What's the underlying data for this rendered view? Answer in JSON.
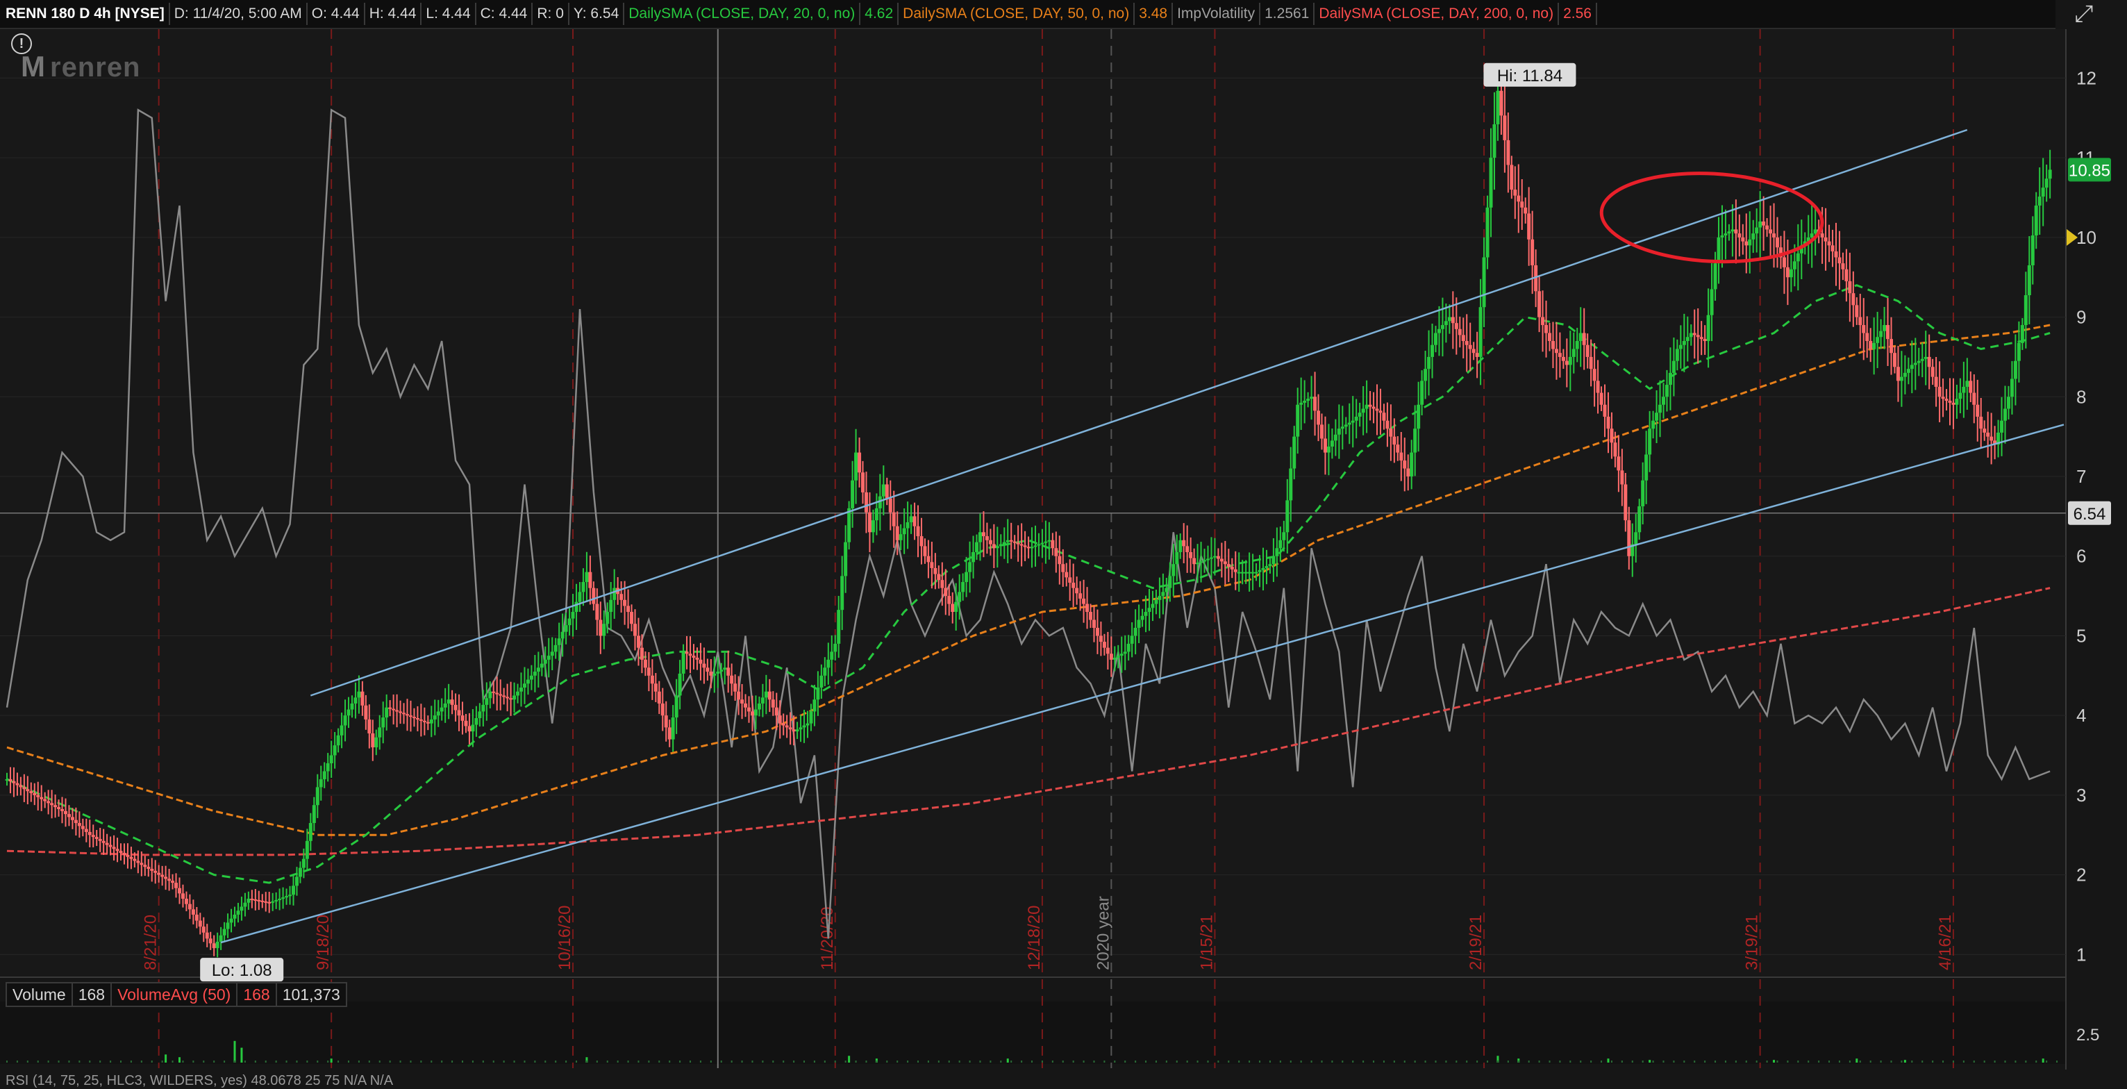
{
  "header": {
    "symbol": "RENN 180 D 4h [NYSE]",
    "date": "D: 11/4/20, 5:00 AM",
    "open": "O: 4.44",
    "high": "H: 4.44",
    "low": "L: 4.44",
    "close": "C: 4.44",
    "range": "R: 0",
    "y": "Y: 6.54",
    "sma20_label": "DailySMA (CLOSE, DAY, 20, 0, no)",
    "sma20_value": "4.62",
    "sma50_label": "DailySMA (CLOSE, DAY, 50, 0, no)",
    "sma50_value": "3.48",
    "iv_label": "ImpVolatility",
    "iv_value": "1.2561",
    "sma200_label": "DailySMA (CLOSE, DAY, 200, 0, no)",
    "sma200_value": "2.56"
  },
  "logo": {
    "text": "renren",
    "mark": "M"
  },
  "info_icon": "!",
  "close_icon": "⤢",
  "volume_header": {
    "label": "Volume",
    "value": "168",
    "avg_label": "VolumeAvg (50)",
    "avg_value": "168",
    "total": "101,373"
  },
  "volume_scale": "2.5",
  "rsi_header": "RSI (14, 75, 25, HLC3, WILDERS, yes)  48.0678  25  75  N/A  N/A",
  "colors": {
    "up": "#27c93f",
    "down": "#ff6b6b",
    "sma20": "#27c93f",
    "sma50": "#e8801a",
    "sma200": "#e04848",
    "iv": "#8a8a8a",
    "channel": "#7fb2d9",
    "annotation": "#e8202a",
    "price_badge": "#1aa33a",
    "marker": "#e0c020"
  },
  "chart_data": {
    "type": "candlestick",
    "title": "RENN 180 D 4h [NYSE]",
    "price_axis": {
      "ticks": [
        1,
        2,
        3,
        4,
        5,
        6,
        7,
        8,
        9,
        10,
        11,
        12
      ],
      "range": [
        0.75,
        12.3
      ]
    },
    "date_labels": [
      "8/21/20",
      "9/18/20",
      "10/16/20",
      "11/20/20",
      "12/18/20",
      "2020 year",
      "1/15/21",
      "2/19/21",
      "3/19/21",
      "4/16/21"
    ],
    "price_badges": {
      "last": "10.85",
      "crosshair": "6.54"
    },
    "high_label": "Hi: 11.84",
    "low_label": "Lo: 1.08",
    "hi": 11.84,
    "lo": 1.08,
    "last": 10.85,
    "crosshair": 6.54,
    "price_path": [
      [
        0,
        3.2
      ],
      [
        4,
        3.0
      ],
      [
        8,
        2.8
      ],
      [
        12,
        2.5
      ],
      [
        16,
        2.3
      ],
      [
        20,
        2.1
      ],
      [
        24,
        1.9
      ],
      [
        27,
        1.5
      ],
      [
        29,
        1.2
      ],
      [
        30,
        1.08
      ],
      [
        32,
        1.4
      ],
      [
        35,
        1.7
      ],
      [
        38,
        1.65
      ],
      [
        41,
        1.75
      ],
      [
        43,
        2.2
      ],
      [
        45,
        3.1
      ],
      [
        47,
        3.5
      ],
      [
        49,
        4.0
      ],
      [
        51,
        4.3
      ],
      [
        53,
        3.6
      ],
      [
        55,
        4.1
      ],
      [
        58,
        4.0
      ],
      [
        61,
        3.9
      ],
      [
        64,
        4.2
      ],
      [
        67,
        3.8
      ],
      [
        70,
        4.3
      ],
      [
        73,
        4.2
      ],
      [
        76,
        4.5
      ],
      [
        79,
        4.8
      ],
      [
        82,
        5.3
      ],
      [
        84,
        5.8
      ],
      [
        86,
        5.0
      ],
      [
        88,
        5.6
      ],
      [
        90,
        5.3
      ],
      [
        92,
        4.7
      ],
      [
        94,
        4.3
      ],
      [
        96,
        3.7
      ],
      [
        98,
        4.8
      ],
      [
        100,
        4.7
      ],
      [
        102,
        4.5
      ],
      [
        104,
        4.6
      ],
      [
        106,
        4.2
      ],
      [
        108,
        4.0
      ],
      [
        110,
        4.3
      ],
      [
        112,
        3.9
      ],
      [
        114,
        3.8
      ],
      [
        116,
        3.9
      ],
      [
        118,
        4.5
      ],
      [
        120,
        4.9
      ],
      [
        122,
        6.6
      ],
      [
        123,
        7.3
      ],
      [
        125,
        6.3
      ],
      [
        127,
        6.9
      ],
      [
        129,
        6.2
      ],
      [
        131,
        6.5
      ],
      [
        133,
        6.0
      ],
      [
        135,
        5.7
      ],
      [
        137,
        5.3
      ],
      [
        139,
        5.8
      ],
      [
        141,
        6.3
      ],
      [
        143,
        6.1
      ],
      [
        145,
        6.2
      ],
      [
        148,
        6.1
      ],
      [
        151,
        6.2
      ],
      [
        153,
        5.8
      ],
      [
        156,
        5.4
      ],
      [
        158,
        5.0
      ],
      [
        160,
        4.7
      ],
      [
        162,
        4.8
      ],
      [
        164,
        5.2
      ],
      [
        166,
        5.4
      ],
      [
        168,
        5.6
      ],
      [
        170,
        6.2
      ],
      [
        172,
        5.9
      ],
      [
        175,
        6.0
      ],
      [
        178,
        5.8
      ],
      [
        181,
        5.8
      ],
      [
        183,
        5.9
      ],
      [
        185,
        6.3
      ],
      [
        187,
        7.9
      ],
      [
        189,
        8.0
      ],
      [
        191,
        7.3
      ],
      [
        193,
        7.6
      ],
      [
        195,
        7.7
      ],
      [
        197,
        7.9
      ],
      [
        199,
        7.8
      ],
      [
        201,
        7.4
      ],
      [
        203,
        7.0
      ],
      [
        205,
        8.2
      ],
      [
        207,
        8.8
      ],
      [
        209,
        9.0
      ],
      [
        211,
        8.7
      ],
      [
        213,
        8.5
      ],
      [
        215,
        11.0
      ],
      [
        216,
        11.84
      ],
      [
        218,
        10.6
      ],
      [
        220,
        10.3
      ],
      [
        222,
        9.0
      ],
      [
        224,
        8.6
      ],
      [
        226,
        8.4
      ],
      [
        228,
        8.8
      ],
      [
        230,
        8.2
      ],
      [
        232,
        7.6
      ],
      [
        234,
        6.9
      ],
      [
        235,
        6.0
      ],
      [
        236,
        6.3
      ],
      [
        238,
        7.6
      ],
      [
        240,
        8.0
      ],
      [
        242,
        8.6
      ],
      [
        244,
        8.8
      ],
      [
        246,
        8.7
      ],
      [
        248,
        10.0
      ],
      [
        250,
        10.1
      ],
      [
        252,
        9.9
      ],
      [
        254,
        10.2
      ],
      [
        256,
        10.0
      ],
      [
        258,
        9.5
      ],
      [
        260,
        9.9
      ],
      [
        262,
        10.1
      ],
      [
        264,
        9.9
      ],
      [
        266,
        9.6
      ],
      [
        268,
        9.0
      ],
      [
        270,
        8.6
      ],
      [
        272,
        8.9
      ],
      [
        274,
        8.2
      ],
      [
        276,
        8.4
      ],
      [
        278,
        8.5
      ],
      [
        280,
        8.0
      ],
      [
        282,
        7.9
      ],
      [
        284,
        8.2
      ],
      [
        286,
        7.6
      ],
      [
        288,
        7.4
      ],
      [
        290,
        8.0
      ],
      [
        292,
        8.9
      ],
      [
        294,
        10.4
      ],
      [
        296,
        10.85
      ]
    ],
    "iv_path": [
      [
        0,
        4.1
      ],
      [
        3,
        5.7
      ],
      [
        5,
        6.2
      ],
      [
        8,
        7.3
      ],
      [
        11,
        7.0
      ],
      [
        13,
        6.3
      ],
      [
        15,
        6.2
      ],
      [
        17,
        6.3
      ],
      [
        19,
        11.6
      ],
      [
        21,
        11.5
      ],
      [
        23,
        9.2
      ],
      [
        25,
        10.4
      ],
      [
        27,
        7.3
      ],
      [
        29,
        6.2
      ],
      [
        31,
        6.5
      ],
      [
        33,
        6.0
      ],
      [
        35,
        6.3
      ],
      [
        37,
        6.6
      ],
      [
        39,
        6.0
      ],
      [
        41,
        6.4
      ],
      [
        43,
        8.4
      ],
      [
        45,
        8.6
      ],
      [
        47,
        11.6
      ],
      [
        49,
        11.5
      ],
      [
        51,
        8.9
      ],
      [
        53,
        8.3
      ],
      [
        55,
        8.6
      ],
      [
        57,
        8.0
      ],
      [
        59,
        8.4
      ],
      [
        61,
        8.1
      ],
      [
        63,
        8.7
      ],
      [
        65,
        7.2
      ],
      [
        67,
        6.9
      ],
      [
        69,
        4.2
      ],
      [
        71,
        4.5
      ],
      [
        73,
        5.1
      ],
      [
        75,
        6.9
      ],
      [
        77,
        5.3
      ],
      [
        79,
        3.9
      ],
      [
        81,
        5.3
      ],
      [
        83,
        9.1
      ],
      [
        85,
        6.8
      ],
      [
        87,
        5.1
      ],
      [
        89,
        5.0
      ],
      [
        91,
        4.7
      ],
      [
        93,
        5.2
      ],
      [
        95,
        4.6
      ],
      [
        97,
        4.2
      ],
      [
        99,
        4.5
      ],
      [
        101,
        4.0
      ],
      [
        103,
        4.8
      ],
      [
        105,
        3.6
      ],
      [
        107,
        5.0
      ],
      [
        109,
        3.3
      ],
      [
        111,
        3.6
      ],
      [
        113,
        4.6
      ],
      [
        115,
        2.9
      ],
      [
        117,
        3.5
      ],
      [
        119,
        1.2
      ],
      [
        121,
        4.2
      ],
      [
        123,
        5.2
      ],
      [
        125,
        6.0
      ],
      [
        127,
        5.5
      ],
      [
        129,
        6.2
      ],
      [
        131,
        5.4
      ],
      [
        133,
        5.0
      ],
      [
        135,
        5.4
      ],
      [
        137,
        5.7
      ],
      [
        139,
        5.0
      ],
      [
        141,
        5.2
      ],
      [
        143,
        5.8
      ],
      [
        145,
        5.4
      ],
      [
        147,
        4.9
      ],
      [
        149,
        5.2
      ],
      [
        151,
        5.0
      ],
      [
        153,
        5.1
      ],
      [
        155,
        4.6
      ],
      [
        157,
        4.4
      ],
      [
        159,
        4.0
      ],
      [
        161,
        4.8
      ],
      [
        163,
        3.3
      ],
      [
        165,
        4.9
      ],
      [
        167,
        4.4
      ],
      [
        169,
        6.3
      ],
      [
        171,
        5.1
      ],
      [
        173,
        6.0
      ],
      [
        175,
        5.6
      ],
      [
        177,
        4.1
      ],
      [
        179,
        5.3
      ],
      [
        181,
        4.8
      ],
      [
        183,
        4.2
      ],
      [
        185,
        5.6
      ],
      [
        187,
        3.3
      ],
      [
        189,
        6.1
      ],
      [
        191,
        5.4
      ],
      [
        193,
        4.8
      ],
      [
        195,
        3.1
      ],
      [
        197,
        5.2
      ],
      [
        199,
        4.3
      ],
      [
        201,
        4.9
      ],
      [
        203,
        5.5
      ],
      [
        205,
        6.0
      ],
      [
        207,
        4.6
      ],
      [
        209,
        3.8
      ],
      [
        211,
        4.9
      ],
      [
        213,
        4.3
      ],
      [
        215,
        5.2
      ],
      [
        217,
        4.5
      ],
      [
        219,
        4.8
      ],
      [
        221,
        5.0
      ],
      [
        223,
        5.9
      ],
      [
        225,
        4.4
      ],
      [
        227,
        5.2
      ],
      [
        229,
        4.9
      ],
      [
        231,
        5.3
      ],
      [
        233,
        5.1
      ],
      [
        235,
        5.0
      ],
      [
        237,
        5.4
      ],
      [
        239,
        5.0
      ],
      [
        241,
        5.2
      ],
      [
        243,
        4.7
      ],
      [
        245,
        4.8
      ],
      [
        247,
        4.3
      ],
      [
        249,
        4.5
      ],
      [
        251,
        4.1
      ],
      [
        253,
        4.3
      ],
      [
        255,
        4.0
      ],
      [
        257,
        4.9
      ],
      [
        259,
        3.9
      ],
      [
        261,
        4.0
      ],
      [
        263,
        3.9
      ],
      [
        265,
        4.1
      ],
      [
        267,
        3.8
      ],
      [
        269,
        4.2
      ],
      [
        271,
        4.0
      ],
      [
        273,
        3.7
      ],
      [
        275,
        3.9
      ],
      [
        277,
        3.5
      ],
      [
        279,
        4.1
      ],
      [
        281,
        3.3
      ],
      [
        283,
        3.9
      ],
      [
        285,
        5.1
      ],
      [
        287,
        3.5
      ],
      [
        289,
        3.2
      ],
      [
        291,
        3.6
      ],
      [
        293,
        3.2
      ],
      [
        296,
        3.3
      ]
    ],
    "sma20_path": [
      [
        0,
        3.2
      ],
      [
        10,
        2.8
      ],
      [
        20,
        2.4
      ],
      [
        30,
        2.0
      ],
      [
        38,
        1.9
      ],
      [
        45,
        2.1
      ],
      [
        52,
        2.5
      ],
      [
        60,
        3.1
      ],
      [
        68,
        3.7
      ],
      [
        75,
        4.1
      ],
      [
        82,
        4.5
      ],
      [
        90,
        4.7
      ],
      [
        97,
        4.8
      ],
      [
        105,
        4.8
      ],
      [
        112,
        4.6
      ],
      [
        118,
        4.3
      ],
      [
        124,
        4.6
      ],
      [
        130,
        5.3
      ],
      [
        136,
        5.8
      ],
      [
        142,
        6.1
      ],
      [
        148,
        6.2
      ],
      [
        154,
        6.0
      ],
      [
        160,
        5.8
      ],
      [
        166,
        5.6
      ],
      [
        172,
        5.7
      ],
      [
        178,
        5.9
      ],
      [
        184,
        6.0
      ],
      [
        190,
        6.6
      ],
      [
        196,
        7.3
      ],
      [
        202,
        7.7
      ],
      [
        208,
        8.0
      ],
      [
        214,
        8.5
      ],
      [
        220,
        9.0
      ],
      [
        226,
        8.9
      ],
      [
        232,
        8.5
      ],
      [
        238,
        8.1
      ],
      [
        244,
        8.4
      ],
      [
        250,
        8.6
      ],
      [
        256,
        8.8
      ],
      [
        262,
        9.2
      ],
      [
        268,
        9.4
      ],
      [
        274,
        9.2
      ],
      [
        280,
        8.8
      ],
      [
        286,
        8.6
      ],
      [
        292,
        8.7
      ],
      [
        296,
        8.8
      ]
    ],
    "sma50_path": [
      [
        0,
        3.6
      ],
      [
        15,
        3.2
      ],
      [
        30,
        2.8
      ],
      [
        45,
        2.5
      ],
      [
        55,
        2.5
      ],
      [
        65,
        2.7
      ],
      [
        80,
        3.1
      ],
      [
        95,
        3.5
      ],
      [
        110,
        3.8
      ],
      [
        120,
        4.2
      ],
      [
        130,
        4.6
      ],
      [
        140,
        5.0
      ],
      [
        150,
        5.3
      ],
      [
        160,
        5.4
      ],
      [
        170,
        5.5
      ],
      [
        180,
        5.7
      ],
      [
        190,
        6.2
      ],
      [
        200,
        6.5
      ],
      [
        210,
        6.8
      ],
      [
        220,
        7.1
      ],
      [
        230,
        7.4
      ],
      [
        240,
        7.7
      ],
      [
        250,
        8.0
      ],
      [
        260,
        8.3
      ],
      [
        270,
        8.6
      ],
      [
        280,
        8.7
      ],
      [
        290,
        8.8
      ],
      [
        296,
        8.9
      ]
    ],
    "sma200_path": [
      [
        0,
        2.3
      ],
      [
        20,
        2.25
      ],
      [
        40,
        2.25
      ],
      [
        60,
        2.3
      ],
      [
        80,
        2.4
      ],
      [
        100,
        2.5
      ],
      [
        120,
        2.7
      ],
      [
        140,
        2.9
      ],
      [
        160,
        3.2
      ],
      [
        180,
        3.5
      ],
      [
        200,
        3.9
      ],
      [
        220,
        4.3
      ],
      [
        240,
        4.7
      ],
      [
        260,
        5.0
      ],
      [
        280,
        5.3
      ],
      [
        296,
        5.6
      ]
    ],
    "channel_upper": [
      [
        44,
        4.25
      ],
      [
        284,
        11.35
      ]
    ],
    "channel_lower": [
      [
        31,
        1.15
      ],
      [
        298,
        7.65
      ]
    ],
    "annotation_ellipse": {
      "center": [
        247,
        10.25
      ],
      "radius_x_bars": 16,
      "radius_y_price": 0.55
    },
    "volume_spikes": [
      [
        23,
        0.6
      ],
      [
        25,
        0.4
      ],
      [
        33,
        1.6
      ],
      [
        34,
        1.1
      ],
      [
        47,
        0.3
      ],
      [
        84,
        0.4
      ],
      [
        122,
        0.5
      ],
      [
        126,
        0.3
      ],
      [
        145,
        0.3
      ],
      [
        216,
        0.5
      ],
      [
        219,
        0.3
      ],
      [
        232,
        0.3
      ],
      [
        238,
        0.2
      ],
      [
        256,
        0.2
      ],
      [
        268,
        0.3
      ],
      [
        275,
        0.2
      ],
      [
        295,
        0.3
      ]
    ],
    "x_domain": [
      0,
      298
    ],
    "volume_max": 4
  }
}
